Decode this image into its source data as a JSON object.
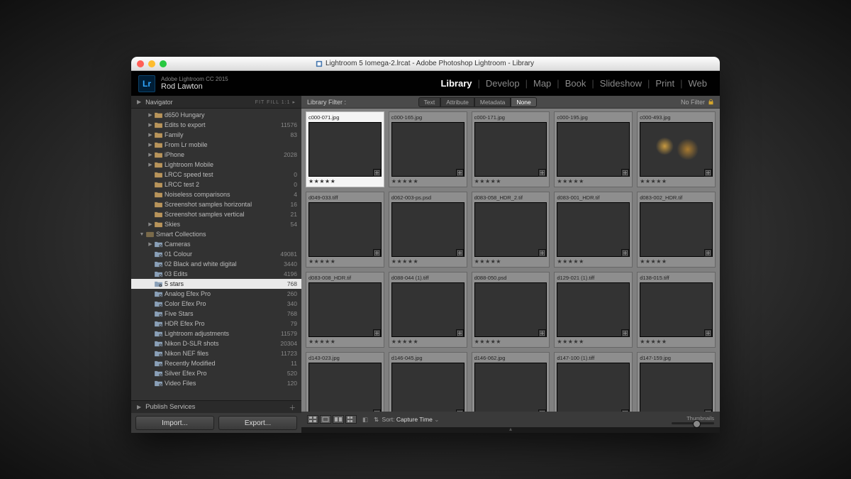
{
  "window_title": "Lightroom 5 Iomega-2.lrcat - Adobe Photoshop Lightroom - Library",
  "product_line": "Adobe Lightroom CC 2015",
  "user_name": "Rod Lawton",
  "logo_text": "Lr",
  "modules": [
    "Library",
    "Develop",
    "Map",
    "Book",
    "Slideshow",
    "Print",
    "Web"
  ],
  "active_module": "Library",
  "navigator": {
    "label": "Navigator",
    "opts": "FIT   FILL   1:1   ▸"
  },
  "filterbar": {
    "label": "Library Filter :",
    "segs": [
      "Text",
      "Attribute",
      "Metadata",
      "None"
    ],
    "on": "None",
    "nofilter": "No Filter"
  },
  "tree": [
    {
      "depth": 2,
      "exp": "▶",
      "icon": "folder",
      "label": "d650 Hungary",
      "count": ""
    },
    {
      "depth": 2,
      "exp": "▶",
      "icon": "folder",
      "label": "Edits to export",
      "count": "11576"
    },
    {
      "depth": 2,
      "exp": "▶",
      "icon": "folder",
      "label": "Family",
      "count": "83"
    },
    {
      "depth": 2,
      "exp": "▶",
      "icon": "folder",
      "label": "From Lr mobile",
      "count": ""
    },
    {
      "depth": 2,
      "exp": "▶",
      "icon": "folder",
      "label": "iPhone",
      "count": "2028"
    },
    {
      "depth": 2,
      "exp": "▶",
      "icon": "folder",
      "label": "Lightroom Mobile",
      "count": ""
    },
    {
      "depth": 2,
      "exp": "",
      "icon": "folder",
      "label": "LRCC speed test",
      "count": "0"
    },
    {
      "depth": 2,
      "exp": "",
      "icon": "folder",
      "label": "LRCC test 2",
      "count": "0"
    },
    {
      "depth": 2,
      "exp": "",
      "icon": "folder",
      "label": "Noiseless comparisons",
      "count": "4"
    },
    {
      "depth": 2,
      "exp": "",
      "icon": "folder",
      "label": "Screenshot samples horizontal",
      "count": "16"
    },
    {
      "depth": 2,
      "exp": "",
      "icon": "folder",
      "label": "Screenshot samples vertical",
      "count": "21"
    },
    {
      "depth": 2,
      "exp": "▶",
      "icon": "folder",
      "label": "Skies",
      "count": "54"
    },
    {
      "depth": 1,
      "exp": "▼",
      "icon": "smart",
      "label": "Smart Collections",
      "count": ""
    },
    {
      "depth": 2,
      "exp": "▶",
      "icon": "gear",
      "label": "Cameras",
      "count": ""
    },
    {
      "depth": 2,
      "exp": "",
      "icon": "gear",
      "label": "01 Colour",
      "count": "49081"
    },
    {
      "depth": 2,
      "exp": "",
      "icon": "gear",
      "label": "02 Black and white digital",
      "count": "3440"
    },
    {
      "depth": 2,
      "exp": "",
      "icon": "gear",
      "label": "03 Edits",
      "count": "4196"
    },
    {
      "depth": 2,
      "exp": "",
      "icon": "gear",
      "label": "5 stars",
      "count": "768",
      "selected": true
    },
    {
      "depth": 2,
      "exp": "",
      "icon": "gear",
      "label": "Analog Efex Pro",
      "count": "260"
    },
    {
      "depth": 2,
      "exp": "",
      "icon": "gear",
      "label": "Color Efex Pro",
      "count": "340"
    },
    {
      "depth": 2,
      "exp": "",
      "icon": "gear",
      "label": "Five Stars",
      "count": "768"
    },
    {
      "depth": 2,
      "exp": "",
      "icon": "gear",
      "label": "HDR Efex Pro",
      "count": "79"
    },
    {
      "depth": 2,
      "exp": "",
      "icon": "gear",
      "label": "Lightroom adjustments",
      "count": "11579"
    },
    {
      "depth": 2,
      "exp": "",
      "icon": "gear",
      "label": "Nikon D-SLR shots",
      "count": "20304"
    },
    {
      "depth": 2,
      "exp": "",
      "icon": "gear",
      "label": "Nikon NEF files",
      "count": "11723"
    },
    {
      "depth": 2,
      "exp": "",
      "icon": "gear",
      "label": "Recently Modified",
      "count": "11"
    },
    {
      "depth": 2,
      "exp": "",
      "icon": "gear",
      "label": "Silver Efex Pro",
      "count": "520"
    },
    {
      "depth": 2,
      "exp": "",
      "icon": "gear",
      "label": "Video Files",
      "count": "120"
    }
  ],
  "publish_services": "Publish Services",
  "buttons": {
    "import": "Import...",
    "export": "Export..."
  },
  "grid": {
    "rows": [
      [
        {
          "name": "c000-071.jpg",
          "cls": "t-ocean",
          "sel": true
        },
        {
          "name": "c000-165.jpg",
          "cls": "t-sunset"
        },
        {
          "name": "c000-171.jpg",
          "cls": "t-harbour"
        },
        {
          "name": "c000-195.jpg",
          "cls": "t-pier"
        },
        {
          "name": "c000-493.jpg",
          "cls": "t-night"
        }
      ],
      [
        {
          "name": "d049-033.tiff",
          "cls": "t-bw1"
        },
        {
          "name": "d062-003-ps.psd",
          "cls": "t-warm"
        },
        {
          "name": "d083-058_HDR_2.tif",
          "cls": "t-bw3"
        },
        {
          "name": "d083-001_HDR.tif",
          "cls": "t-bw4"
        },
        {
          "name": "d083-002_HDR.tif",
          "cls": "t-bw5"
        }
      ],
      [
        {
          "name": "d083-008_HDR.tif",
          "cls": "t-brick"
        },
        {
          "name": "d088-044 (1).tiff",
          "cls": "t-ring"
        },
        {
          "name": "d088-050.psd",
          "cls": "t-storm"
        },
        {
          "name": "d129-021 (1).tiff",
          "cls": "t-clock"
        },
        {
          "name": "d138-015.tiff",
          "cls": "t-tree"
        }
      ],
      [
        {
          "name": "d143-023.jpg",
          "cls": "t-window"
        },
        {
          "name": "d146-045.jpg",
          "cls": "t-bw2"
        },
        {
          "name": "d146-062.jpg",
          "cls": "t-coast"
        },
        {
          "name": "d147-100 (1).tiff",
          "cls": "t-bw2"
        },
        {
          "name": "d147-159.jpg",
          "cls": "t-blue"
        }
      ]
    ],
    "stars": "★★★★★"
  },
  "toolbar": {
    "sort_label": "Sort:",
    "sort_value": "Capture Time",
    "thumbs": "Thumbnails"
  }
}
